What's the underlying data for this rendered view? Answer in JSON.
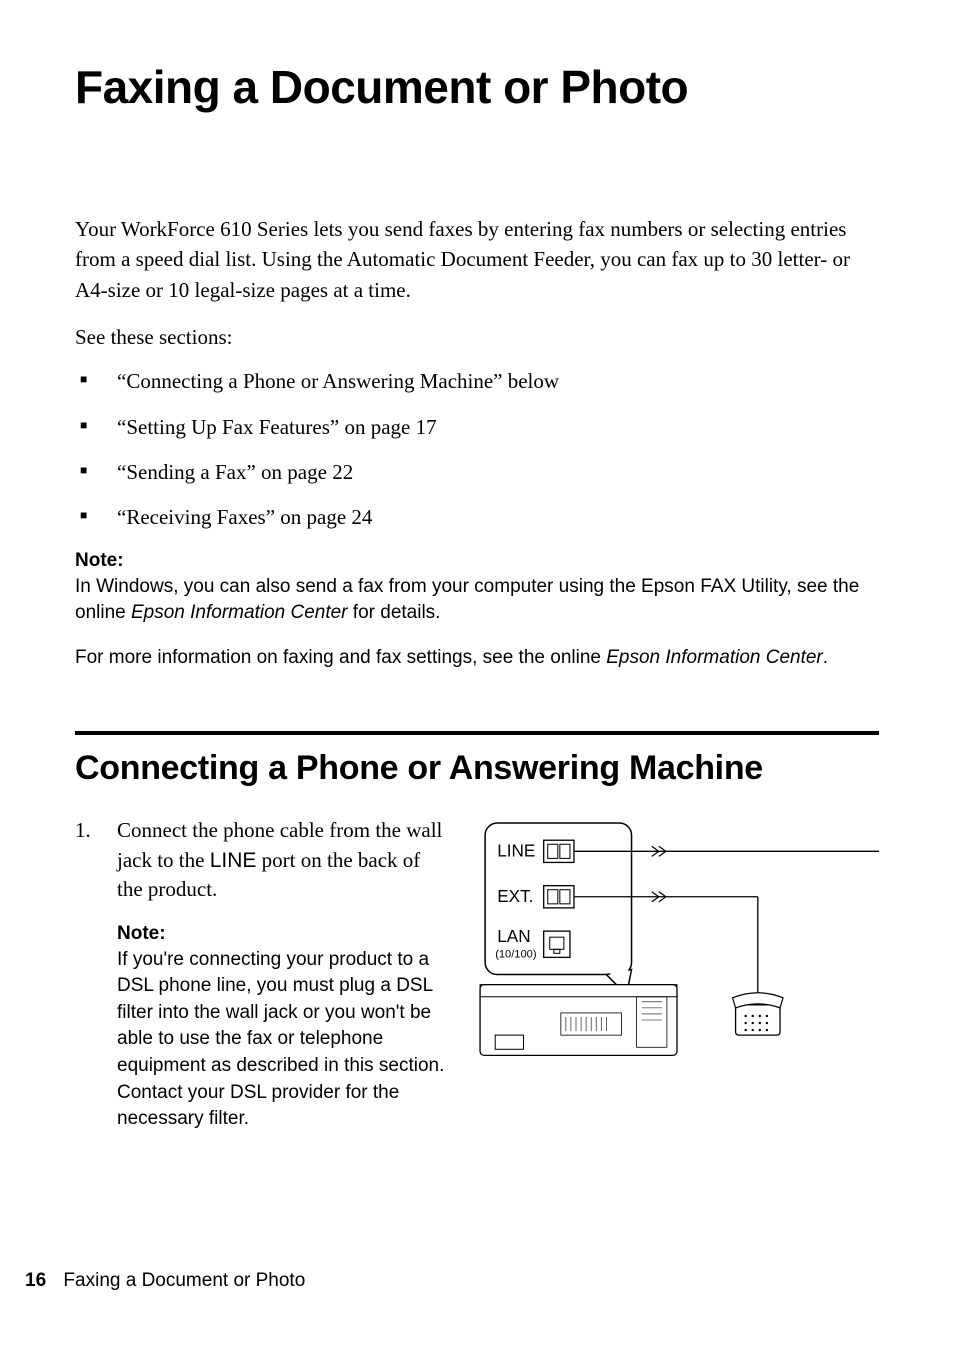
{
  "title": "Faxing a Document or Photo",
  "intro": "Your WorkForce 610 Series lets you send faxes by entering fax numbers or selecting entries from a speed dial list. Using the Automatic Document Feeder, you can fax up to 30 letter- or A4-size or 10 legal-size pages at a time.",
  "see_sections": "See these sections:",
  "bullets": [
    "“Connecting a Phone or Answering Machine” below",
    "“Setting Up Fax Features” on page 17",
    "“Sending a Fax” on page 22",
    "“Receiving Faxes” on page 24"
  ],
  "note1": {
    "label": "Note:",
    "body_a": "In Windows, you can also send a fax from your computer using the Epson FAX Utility, see the online ",
    "italic_a": "Epson Information Center",
    "body_b": " for details."
  },
  "more_info": {
    "text_a": "For more information on faxing and fax settings, see the online ",
    "italic": "Epson Information Center",
    "text_b": "."
  },
  "section_heading": "Connecting a Phone or Answering Machine",
  "step1": {
    "num": "1.",
    "text_a": "Connect the phone cable from the wall jack to the ",
    "line_word": "LINE",
    "text_b": " port on the back of the product."
  },
  "note2": {
    "label": "Note:",
    "body": "If you're connecting your product to a DSL phone line, you must plug a DSL filter into the wall jack or you won't be able to use the fax or telephone equipment as described in this section. Contact your DSL provider for the necessary filter."
  },
  "diagram_labels": {
    "line": "LINE",
    "ext": "EXT.",
    "lan": "LAN",
    "lan_sub": "(10/100)"
  },
  "footer": {
    "page": "16",
    "title": "Faxing a Document or Photo"
  }
}
